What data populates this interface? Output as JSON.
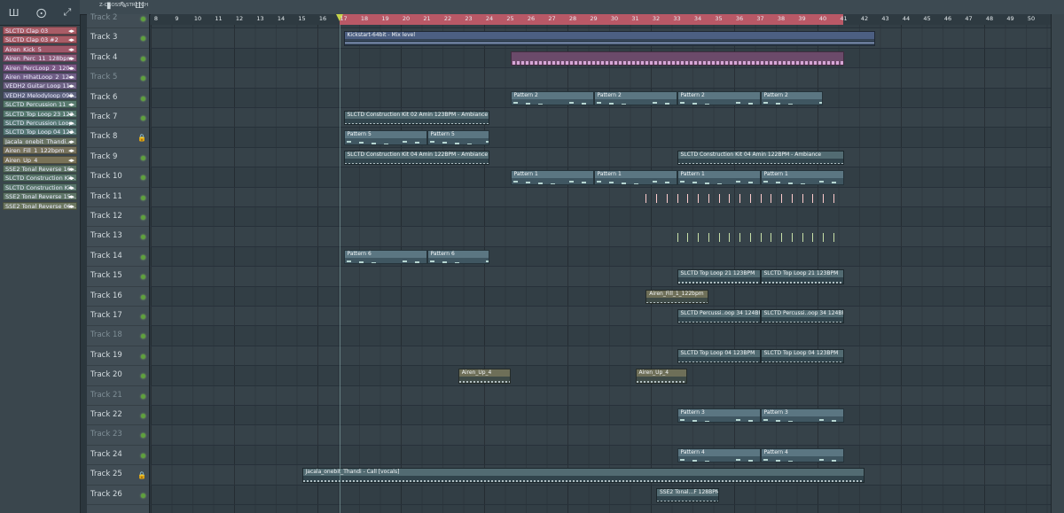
{
  "toolbar": {
    "tools": [
      "▮",
      "✎",
      "Ш"
    ],
    "zoom_label": "Z-CROSS",
    "stretch_label": "STRETCH"
  },
  "browser": {
    "tabs": [
      "Ш",
      "⨀",
      "⤢"
    ],
    "items": [
      {
        "label": "SLCTD Clap 03",
        "color": "#a95c66"
      },
      {
        "label": "SLCTD Clap 03 #2",
        "color": "#a95c66"
      },
      {
        "label": "Airen_Kick_5",
        "color": "#a0586a"
      },
      {
        "label": "Airen_Perc_11_128bpm",
        "color": "#8d5c7a"
      },
      {
        "label": "Airen_PercLoop_2_120...",
        "color": "#7c5a86"
      },
      {
        "label": "Airen_HihatLoop_2_12...",
        "color": "#6f5e86"
      },
      {
        "label": "VEDH2 Guitar Loop 11...",
        "color": "#6d6284"
      },
      {
        "label": "VEDH2 Melodyloop 090...",
        "color": "#5f6480"
      },
      {
        "label": "SLCTD Percussion 11",
        "color": "#587a6e"
      },
      {
        "label": "SLCTD Top Loop 23 123...",
        "color": "#577a70"
      },
      {
        "label": "SLCTD Percussion Loop...",
        "color": "#567874"
      },
      {
        "label": "SLCTD Top Loop 04 123...",
        "color": "#567876"
      },
      {
        "label": "Jacala_onebit_Thandi...",
        "color": "#6a7565"
      },
      {
        "label": "Airen_Fill_1_122bpm",
        "color": "#78735d"
      },
      {
        "label": "Airen_Up_4",
        "color": "#7a7358"
      },
      {
        "label": "SSE2 Tonal Reverse 16...",
        "color": "#5e7566"
      },
      {
        "label": "SLCTD Construction Kit ...",
        "color": "#587569"
      },
      {
        "label": "SLCTD Construction Kit...",
        "color": "#58756b"
      },
      {
        "label": "SSE2 Tonal Reverse 15...",
        "color": "#5e7567"
      },
      {
        "label": "SSE2 Tonal Reverse 06...",
        "color": "#6c7760"
      }
    ]
  },
  "ruler": {
    "bars": [
      "8",
      "9",
      "10",
      "11",
      "12",
      "13",
      "14",
      "15",
      "16",
      "17",
      "18",
      "19",
      "20",
      "21",
      "22",
      "23",
      "24",
      "25",
      "26",
      "27",
      "28",
      "29",
      "30",
      "31",
      "32",
      "33",
      "34",
      "35",
      "36",
      "37",
      "38",
      "39",
      "40",
      "41",
      "42",
      "43",
      "44",
      "45",
      "46",
      "47",
      "48",
      "49",
      "50"
    ]
  },
  "tracks": [
    {
      "name": "Track 2",
      "led": true,
      "dim": true
    },
    {
      "name": "Track 3",
      "led": true
    },
    {
      "name": "Track 4",
      "led": true
    },
    {
      "name": "Track 5",
      "led": true,
      "dim": true
    },
    {
      "name": "Track 6",
      "led": true
    },
    {
      "name": "Track 7",
      "led": true
    },
    {
      "name": "Track 8",
      "led": false,
      "lock": true
    },
    {
      "name": "Track 9",
      "led": true
    },
    {
      "name": "Track 10",
      "led": true
    },
    {
      "name": "Track 11",
      "led": true
    },
    {
      "name": "Track 12",
      "led": true
    },
    {
      "name": "Track 13",
      "led": true
    },
    {
      "name": "Track 14",
      "led": true
    },
    {
      "name": "Track 15",
      "led": true
    },
    {
      "name": "Track 16",
      "led": true
    },
    {
      "name": "Track 17",
      "led": true
    },
    {
      "name": "Track 18",
      "led": true,
      "dim": true
    },
    {
      "name": "Track 19",
      "led": true
    },
    {
      "name": "Track 20",
      "led": true
    },
    {
      "name": "Track 21",
      "led": true,
      "dim": true
    },
    {
      "name": "Track 22",
      "led": true
    },
    {
      "name": "Track 23",
      "led": true,
      "dim": true
    },
    {
      "name": "Track 24",
      "led": true
    },
    {
      "name": "Track 25",
      "led": false,
      "lock": true
    },
    {
      "name": "Track 26",
      "led": true
    }
  ],
  "clips": [
    {
      "t": 1,
      "s": 17,
      "e": 42.5,
      "kind": "auto",
      "label": "Kickstart-64bit - Mix level"
    },
    {
      "t": 2,
      "s": 25,
      "e": 41,
      "kind": "pink",
      "label": ""
    },
    {
      "t": 4,
      "s": 25,
      "e": 29,
      "kind": "pat",
      "label": "Pattern 2"
    },
    {
      "t": 4,
      "s": 29,
      "e": 33,
      "kind": "pat",
      "label": "Pattern 2"
    },
    {
      "t": 4,
      "s": 33,
      "e": 37,
      "kind": "pat",
      "label": "Pattern 2"
    },
    {
      "t": 4,
      "s": 37,
      "e": 40,
      "kind": "pat",
      "label": "Pattern 2"
    },
    {
      "t": 5,
      "s": 17,
      "e": 24,
      "kind": "aud",
      "label": "SLCTD Construction Kit 02 Amin 123BPM - Ambiance"
    },
    {
      "t": 6,
      "s": 17,
      "e": 21,
      "kind": "pat",
      "label": "Pattern 5"
    },
    {
      "t": 6,
      "s": 21,
      "e": 24,
      "kind": "pat",
      "label": "Pattern 5"
    },
    {
      "t": 7,
      "s": 17,
      "e": 24,
      "kind": "aud",
      "label": "SLCTD Construction Kit 04 Amin 122BPM - Ambiance"
    },
    {
      "t": 7,
      "s": 33,
      "e": 41,
      "kind": "aud",
      "label": "SLCTD Construction Kit 04 Amin 122BPM - Ambiance"
    },
    {
      "t": 8,
      "s": 25,
      "e": 29,
      "kind": "pat",
      "label": "Pattern 1"
    },
    {
      "t": 8,
      "s": 29,
      "e": 33,
      "kind": "pat",
      "label": "Pattern 1"
    },
    {
      "t": 8,
      "s": 33,
      "e": 37,
      "kind": "pat",
      "label": "Pattern 1"
    },
    {
      "t": 8,
      "s": 37,
      "e": 41,
      "kind": "pat",
      "label": "Pattern 1"
    },
    {
      "t": 12,
      "s": 17,
      "e": 21,
      "kind": "pat",
      "label": "Pattern 6"
    },
    {
      "t": 12,
      "s": 21,
      "e": 24,
      "kind": "pat",
      "label": "Pattern 6"
    },
    {
      "t": 13,
      "s": 33,
      "e": 37,
      "kind": "aud",
      "label": "SLCTD Top Loop 21 123BPM"
    },
    {
      "t": 13,
      "s": 37,
      "e": 41,
      "kind": "aud",
      "label": "SLCTD Top Loop 21 123BPM"
    },
    {
      "t": 14,
      "s": 31.5,
      "e": 34.5,
      "kind": "tan",
      "label": "Airen_Fill_1_122bpm"
    },
    {
      "t": 15,
      "s": 33,
      "e": 37,
      "kind": "aud",
      "label": "SLCTD Percussi..oop 34 124BPM"
    },
    {
      "t": 15,
      "s": 37,
      "e": 41,
      "kind": "aud",
      "label": "SLCTD Percussi..oop 34 124BPM"
    },
    {
      "t": 17,
      "s": 33,
      "e": 37,
      "kind": "aud",
      "label": "SLCTD Top Loop 04 123BPM"
    },
    {
      "t": 17,
      "s": 37,
      "e": 41,
      "kind": "aud",
      "label": "SLCTD Top Loop 04 123BPM"
    },
    {
      "t": 18,
      "s": 22.5,
      "e": 25,
      "kind": "tan",
      "label": "Airen_Up_4"
    },
    {
      "t": 18,
      "s": 31,
      "e": 33.5,
      "kind": "tan",
      "label": "Airen_Up_4"
    },
    {
      "t": 20,
      "s": 33,
      "e": 37,
      "kind": "pat",
      "label": "Pattern 3"
    },
    {
      "t": 20,
      "s": 37,
      "e": 41,
      "kind": "pat",
      "label": "Pattern 3"
    },
    {
      "t": 22,
      "s": 33,
      "e": 37,
      "kind": "pat",
      "label": "Pattern 4"
    },
    {
      "t": 22,
      "s": 37,
      "e": 41,
      "kind": "pat",
      "label": "Pattern 4"
    },
    {
      "t": 23,
      "s": 15,
      "e": 42,
      "kind": "aud",
      "label": "Jacala_onebit_Thandi - Call [vocals]"
    },
    {
      "t": 24,
      "s": 32,
      "e": 35,
      "kind": "aud",
      "label": "SSE2 Tonal...F 128BPM"
    }
  ],
  "markers": [
    {
      "t": 9,
      "s": 31.5,
      "e": 41,
      "color": "#ffcccc"
    },
    {
      "t": 11,
      "s": 33,
      "e": 41,
      "color": "#c8e0a8"
    }
  ]
}
